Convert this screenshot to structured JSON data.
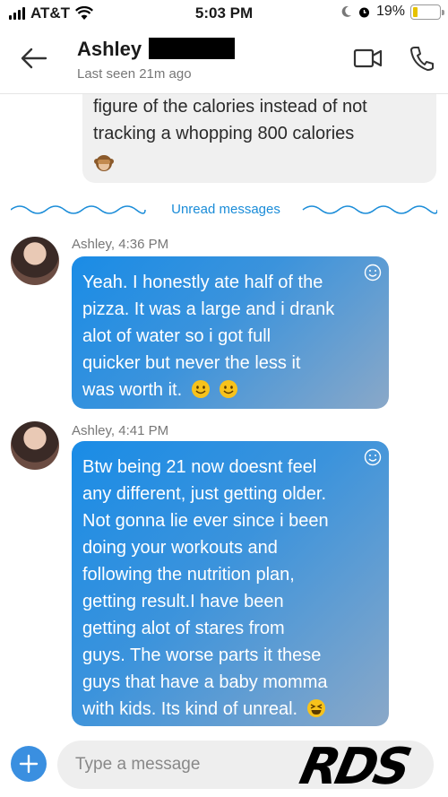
{
  "status_bar": {
    "carrier": "AT&T",
    "time": "5:03 PM",
    "battery": "19%",
    "battery_level": 0.19
  },
  "header": {
    "contact_name": "Ashley",
    "last_seen": "Last seen 21m ago",
    "icons": [
      "back-arrow-icon",
      "video-call-icon",
      "phone-call-icon"
    ]
  },
  "previous_message": {
    "lines": [
      "figure of the calories instead of not",
      "tracking a whopping 800 calories"
    ],
    "emoji": "see-no-evil-monkey"
  },
  "divider": {
    "label": "Unread messages"
  },
  "messages": [
    {
      "meta": "Ashley, 4:36 PM",
      "lines": [
        "Yeah. I honestly ate half of the",
        "pizza. It was a large and i drank",
        "alot of water so i got full",
        "quicker but never the less it",
        "was worth it."
      ],
      "emojis": [
        "smiling-face",
        "smiling-face"
      ]
    },
    {
      "meta": "Ashley, 4:41 PM",
      "lines": [
        "Btw being 21 now doesnt feel",
        "any different, just getting older.",
        "Not gonna lie ever since i been",
        "doing your workouts and",
        "following the nutrition plan,",
        "getting result.I have been",
        "getting alot of stares from",
        "guys. The worse parts it these",
        "guys that have a baby momma",
        "with kids. Its kind of unreal."
      ],
      "emojis": [
        "grinning-squint-face"
      ]
    }
  ],
  "composer": {
    "placeholder": "Type a message"
  },
  "watermark": "RDS",
  "colors": {
    "accent": "#1a8cd8",
    "bubble_start": "#1a8ce6",
    "bubble_end": "#8aa8c8"
  }
}
